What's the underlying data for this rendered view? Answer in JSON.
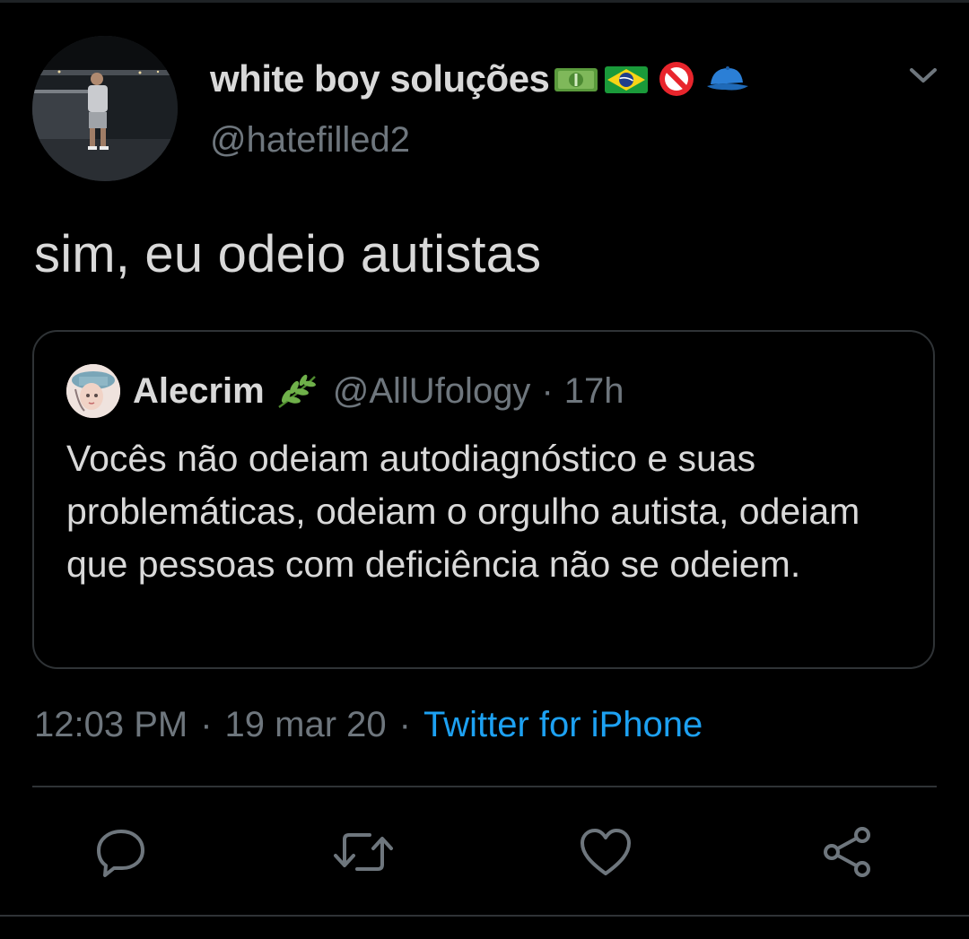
{
  "tweet": {
    "author": {
      "display_name": "white boy soluções",
      "name_emojis": [
        "money-bill-emoji",
        "brazil-flag-emoji",
        "prohibited-emoji",
        "blue-cap-emoji"
      ],
      "handle": "@hatefilled2"
    },
    "text": "sim, eu odeio autistas",
    "quoted": {
      "author_name": "Alecrim",
      "name_emoji": "herb-emoji",
      "handle": "@AllUfology",
      "separator": "·",
      "time": "17h",
      "text": "Vocês não odeiam autodiagnóstico e suas problemáticas, odeiam o orgulho autista, odeiam que pessoas com deficiência não se odeiem."
    },
    "meta": {
      "time": "12:03 PM",
      "dot": "·",
      "date": "19 mar 20",
      "source": "Twitter for iPhone"
    },
    "actions": [
      "reply-icon",
      "retweet-icon",
      "like-icon",
      "share-icon"
    ]
  },
  "colors": {
    "background": "#000000",
    "primary_text": "#d9d9d9",
    "secondary_text": "#6e767d",
    "link": "#1da1f2",
    "border": "#2f3336"
  }
}
